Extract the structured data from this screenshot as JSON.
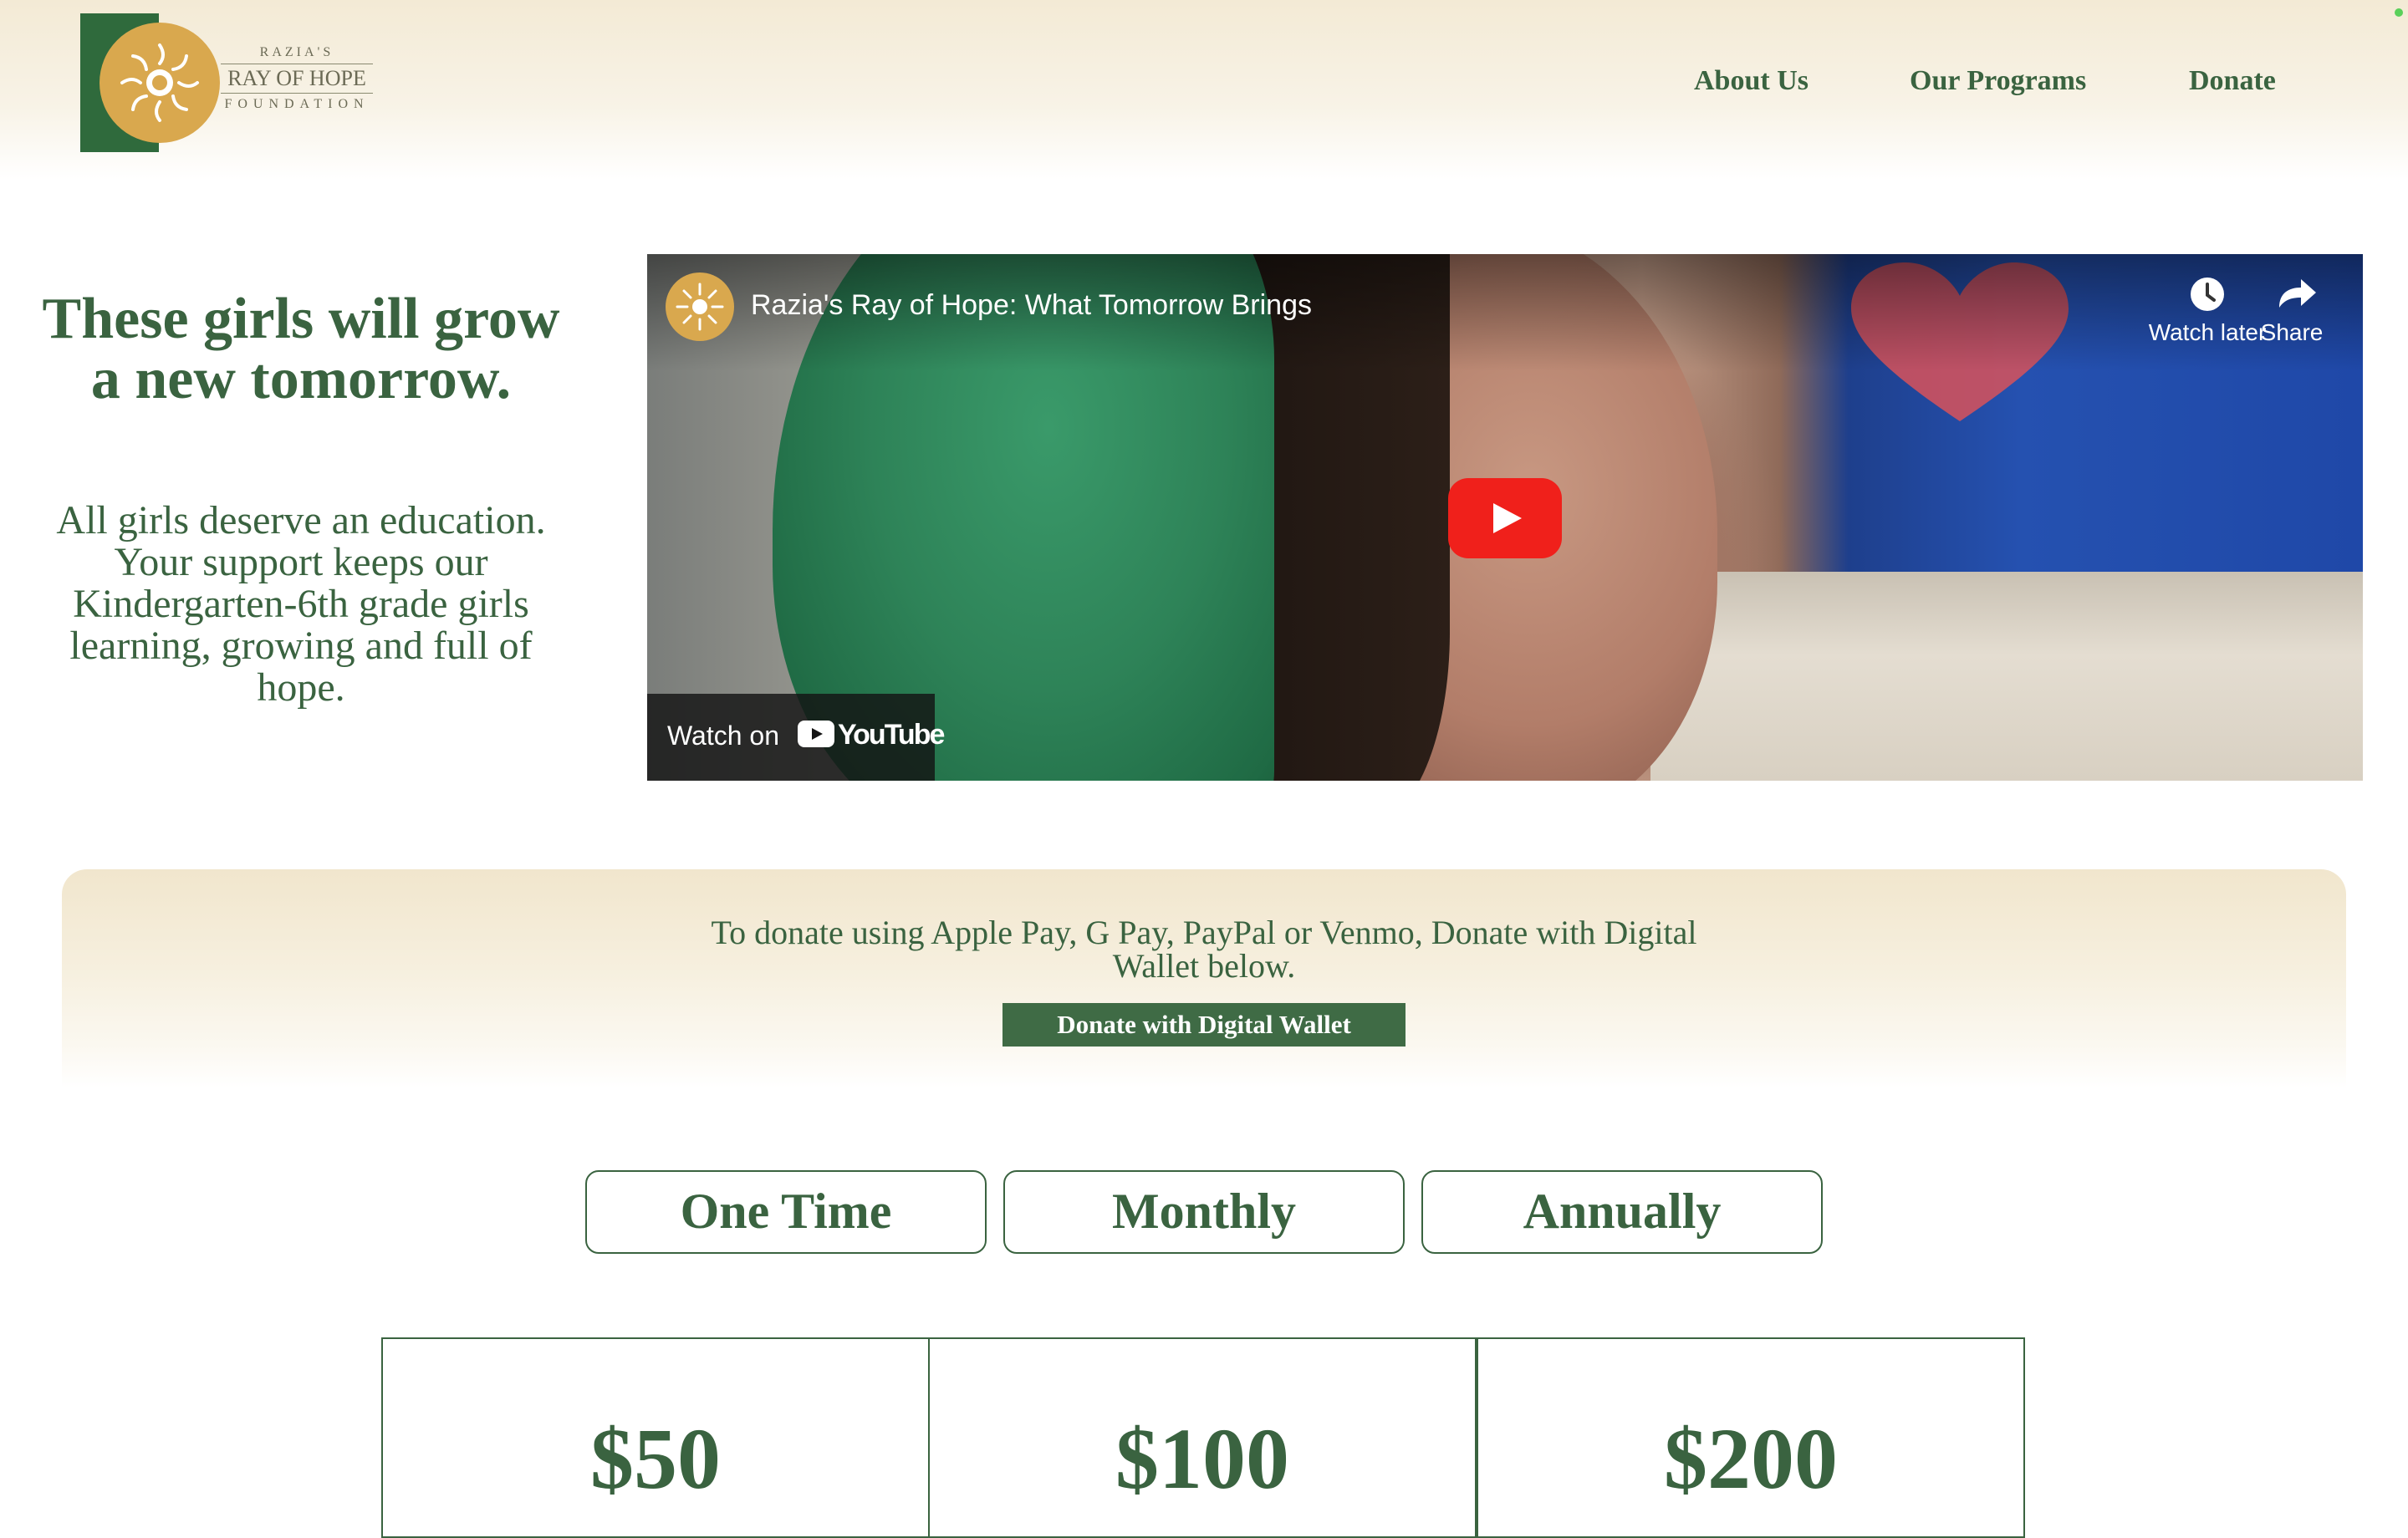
{
  "brand": {
    "line1": "RAZIA'S",
    "line2": "RAY OF HOPE",
    "line3": "FOUNDATION",
    "colors": {
      "green": "#3a6340",
      "gold": "#d9a84e",
      "cream": "#f3ead5"
    }
  },
  "nav": {
    "items": [
      {
        "label": "About Us"
      },
      {
        "label": "Our Programs"
      },
      {
        "label": "Donate"
      }
    ]
  },
  "hero": {
    "title": "These girls will grow a new tomorrow.",
    "subtitle": "All girls deserve an education. Your support keeps our Kindergarten-6th grade girls learning, growing and full of hope."
  },
  "video": {
    "title": "Razia's Ray of Hope: What Tomorrow Brings",
    "watch_later": "Watch later",
    "share": "Share",
    "watch_on": "Watch on",
    "platform": "YouTube",
    "icons": [
      "clock-icon",
      "share-arrow-icon",
      "play-icon",
      "youtube-logo-icon"
    ]
  },
  "wallet": {
    "text": "To donate using Apple Pay, G Pay, PayPal or Venmo, Donate with Digital Wallet below.",
    "button": "Donate with Digital Wallet"
  },
  "frequency": {
    "options": [
      "One Time",
      "Monthly",
      "Annually"
    ]
  },
  "amounts": [
    "$50",
    "$100",
    "$200"
  ]
}
